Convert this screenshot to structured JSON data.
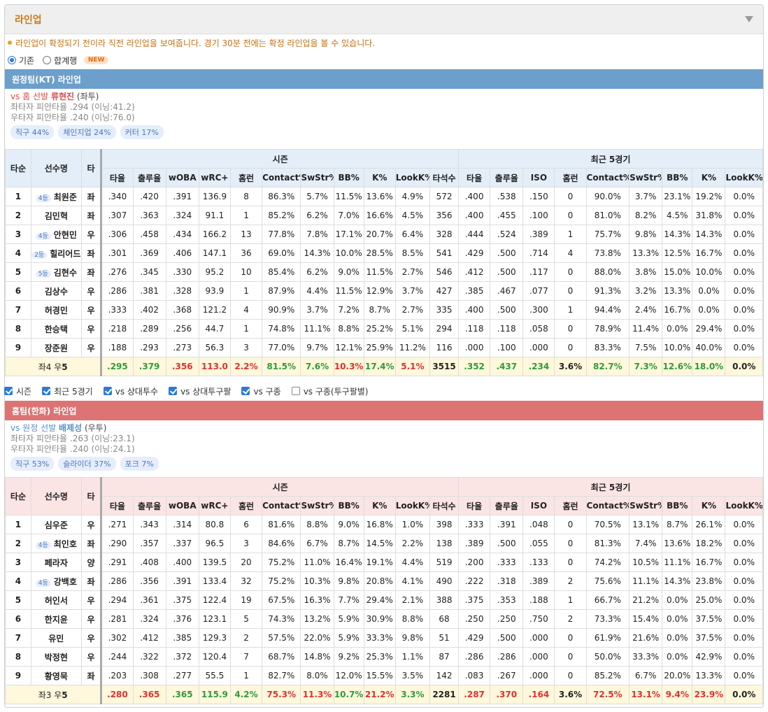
{
  "panel": {
    "title": "라인업"
  },
  "notice": "라인업이 확정되기 전이라 직전 라인업을 보여줍니다. 경기 30분 전에는 확정 라인업을 볼 수 있습니다.",
  "view_options": {
    "basic": "기존",
    "combined": "합계행",
    "new_badge": "NEW"
  },
  "header": {
    "order": "타순",
    "name": "선수명",
    "hand": "타",
    "season": "시즌",
    "recent": "최근 5경기",
    "season_cols": [
      "타율",
      "출루율",
      "wOBA",
      "wRC+",
      "홈런",
      "Contact%",
      "SwStr%",
      "BB%",
      "K%",
      "LookK%",
      "타석수"
    ],
    "recent_cols": [
      "타율",
      "출루율",
      "ISO",
      "홈런",
      "Contact%",
      "SwStr%",
      "BB%",
      "K%",
      "LookK%"
    ]
  },
  "away": {
    "title": "원정팀(KT) 라인업",
    "vs_prefix": "vs 홈 선발",
    "pitcher": "류현진",
    "pitcher_hand": "(좌투)",
    "split_left": "좌타자 피안타율 .294 (이닝:41.2)",
    "split_right": "우타자 피안타율 .240 (이닝:76.0)",
    "chips": [
      "직구 44%",
      "체인지업 24%",
      "커터 17%"
    ],
    "rows": [
      [
        "1",
        "4등",
        "최원준",
        "좌",
        ".340",
        ".420",
        ".391",
        "136.9",
        "8",
        "86.3%",
        "5.7%",
        "11.5%",
        "13.6%",
        "4.9%",
        "572",
        ".400",
        ".538",
        ".150",
        "0",
        "90.0%",
        "3.7%",
        "23.1%",
        "19.2%",
        "0.0%"
      ],
      [
        "2",
        "",
        "김민혁",
        "좌",
        ".307",
        ".363",
        ".324",
        "91.1",
        "1",
        "85.2%",
        "6.2%",
        "7.0%",
        "16.6%",
        "4.5%",
        "356",
        ".400",
        ".455",
        ".100",
        "0",
        "81.0%",
        "8.2%",
        "4.5%",
        "31.8%",
        "0.0%"
      ],
      [
        "3",
        "4등",
        "안현민",
        "우",
        ".306",
        ".458",
        ".434",
        "166.2",
        "13",
        "77.8%",
        "7.8%",
        "17.1%",
        "20.7%",
        "6.4%",
        "328",
        ".444",
        ".524",
        ".389",
        "1",
        "75.7%",
        "9.8%",
        "14.3%",
        "14.3%",
        "0.0%"
      ],
      [
        "4",
        "2등",
        "힐리어드",
        "좌",
        ".301",
        ".369",
        ".406",
        "147.1",
        "36",
        "69.0%",
        "14.3%",
        "10.0%",
        "28.5%",
        "8.5%",
        "541",
        ".429",
        ".500",
        ".714",
        "4",
        "73.8%",
        "13.3%",
        "12.5%",
        "16.7%",
        "0.0%"
      ],
      [
        "5",
        "5등",
        "김현수",
        "좌",
        ".276",
        ".345",
        ".330",
        "95.2",
        "10",
        "85.4%",
        "6.2%",
        "9.0%",
        "11.5%",
        "2.7%",
        "546",
        ".412",
        ".500",
        ".117",
        "0",
        "88.0%",
        "3.8%",
        "15.0%",
        "10.0%",
        "0.0%"
      ],
      [
        "6",
        "",
        "김상수",
        "우",
        ".286",
        ".381",
        ".328",
        "93.9",
        "1",
        "87.9%",
        "4.4%",
        "11.5%",
        "12.9%",
        "3.7%",
        "427",
        ".385",
        ".467",
        ".077",
        "0",
        "91.3%",
        "3.2%",
        "13.3%",
        "0.0%",
        "0.0%"
      ],
      [
        "7",
        "",
        "허경민",
        "우",
        ".333",
        ".402",
        ".368",
        "121.2",
        "4",
        "90.9%",
        "3.7%",
        "7.2%",
        "8.7%",
        "2.7%",
        "335",
        ".400",
        ".500",
        ".300",
        "1",
        "94.4%",
        "2.4%",
        "16.7%",
        "0.0%",
        "0.0%"
      ],
      [
        "8",
        "",
        "한승택",
        "우",
        ".218",
        ".289",
        ".256",
        "44.7",
        "1",
        "74.8%",
        "11.1%",
        "8.8%",
        "25.2%",
        "5.1%",
        "294",
        ".118",
        ".118",
        ".058",
        "0",
        "78.9%",
        "11.4%",
        "0.0%",
        "29.4%",
        "0.0%"
      ],
      [
        "9",
        "",
        "장준원",
        "우",
        ".188",
        ".293",
        ".273",
        "56.3",
        "3",
        "77.0%",
        "9.7%",
        "12.1%",
        "25.9%",
        "11.2%",
        "116",
        ".000",
        ".100",
        ".000",
        "0",
        "83.3%",
        "7.5%",
        "10.0%",
        "40.0%",
        "0.0%"
      ]
    ],
    "total": {
      "label_a": "좌4 우",
      "label_b": "5",
      "vals": [
        ".295",
        ".379",
        ".356",
        "113.0",
        "2.2%",
        "81.5%",
        "7.6%",
        "10.3%",
        "17.4%",
        "5.1%",
        "3515",
        ".352",
        ".437",
        ".234",
        "3.6%",
        "82.7%",
        "7.3%",
        "12.6%",
        "18.0%",
        "0.0%"
      ],
      "colors": [
        "g",
        "g",
        "r",
        "r",
        "r",
        "g",
        "g",
        "r",
        "g",
        "r",
        "",
        "g",
        "g",
        "g",
        "",
        "g",
        "g",
        "g",
        "g",
        ""
      ]
    }
  },
  "filters": [
    "시즌",
    "최근 5경기",
    "vs 상대투수",
    "vs 상대투구팔",
    "vs 구종",
    "vs 구종(투구팔별)"
  ],
  "home": {
    "title": "홈팀(한화) 라인업",
    "vs_prefix": "vs 원정 선발",
    "pitcher": "배제성",
    "pitcher_hand": "(우투)",
    "split_left": "좌타자 피안타율 .263 (이닝:23.1)",
    "split_right": "우타자 피안타율 .240 (이닝:24.1)",
    "chips": [
      "직구 53%",
      "슬라이더 37%",
      "포크 7%"
    ],
    "rows": [
      [
        "1",
        "",
        "심우준",
        "우",
        ".271",
        ".343",
        ".314",
        "80.8",
        "6",
        "81.6%",
        "8.8%",
        "9.0%",
        "16.8%",
        "1.0%",
        "398",
        ".333",
        ".391",
        ".048",
        "0",
        "70.5%",
        "13.1%",
        "8.7%",
        "26.1%",
        "0.0%"
      ],
      [
        "2",
        "4등",
        "최인호",
        "좌",
        ".290",
        ".357",
        ".337",
        "96.5",
        "3",
        "84.6%",
        "6.7%",
        "8.7%",
        "14.5%",
        "2.2%",
        "138",
        ".389",
        ".500",
        ".055",
        "0",
        "81.3%",
        "7.4%",
        "13.6%",
        "18.2%",
        "0.0%"
      ],
      [
        "3",
        "",
        "페라자",
        "양",
        ".291",
        ".408",
        ".400",
        "139.5",
        "20",
        "75.2%",
        "11.0%",
        "16.4%",
        "19.1%",
        "4.4%",
        "519",
        ".200",
        ".333",
        ".133",
        "0",
        "74.2%",
        "10.5%",
        "11.1%",
        "16.7%",
        "0.0%"
      ],
      [
        "4",
        "4등",
        "강백호",
        "좌",
        ".286",
        ".356",
        ".391",
        "133.4",
        "32",
        "75.2%",
        "10.3%",
        "9.8%",
        "20.8%",
        "4.1%",
        "490",
        ".222",
        ".318",
        ".389",
        "2",
        "75.6%",
        "11.1%",
        "14.3%",
        "23.8%",
        "0.0%"
      ],
      [
        "5",
        "",
        "허인서",
        "우",
        ".294",
        ".361",
        ".375",
        "122.4",
        "19",
        "67.5%",
        "16.3%",
        "7.7%",
        "29.4%",
        "2.1%",
        "388",
        ".375",
        ".353",
        ".188",
        "1",
        "66.7%",
        "21.2%",
        "0.0%",
        "25.0%",
        "0.0%"
      ],
      [
        "6",
        "",
        "한지윤",
        "우",
        ".281",
        ".324",
        ".376",
        "123.1",
        "5",
        "74.3%",
        "13.2%",
        "5.9%",
        "30.9%",
        "8.8%",
        "68",
        ".250",
        ".250",
        ".750",
        "2",
        "73.3%",
        "15.4%",
        "0.0%",
        "37.5%",
        "0.0%"
      ],
      [
        "7",
        "",
        "유민",
        "우",
        ".302",
        ".412",
        ".385",
        "129.3",
        "2",
        "57.5%",
        "22.0%",
        "5.9%",
        "33.3%",
        "9.8%",
        "51",
        ".429",
        ".500",
        ".000",
        "0",
        "61.9%",
        "21.6%",
        "0.0%",
        "37.5%",
        "0.0%"
      ],
      [
        "8",
        "",
        "박정현",
        "우",
        ".244",
        ".322",
        ".372",
        "120.4",
        "7",
        "68.7%",
        "14.8%",
        "9.2%",
        "25.3%",
        "1.1%",
        "87",
        ".286",
        ".286",
        ".000",
        "0",
        "50.0%",
        "33.3%",
        "0.0%",
        "42.9%",
        "0.0%"
      ],
      [
        "9",
        "",
        "황영묵",
        "좌",
        ".203",
        ".308",
        ".277",
        "55.5",
        "1",
        "82.7%",
        "8.0%",
        "12.0%",
        "15.5%",
        "3.5%",
        "142",
        ".083",
        ".267",
        ".000",
        "0",
        "85.2%",
        "6.7%",
        "20.0%",
        "13.3%",
        "0.0%"
      ]
    ],
    "total": {
      "label_a": "좌3 우",
      "label_b": "5",
      "vals": [
        ".280",
        ".365",
        ".365",
        "115.9",
        "4.2%",
        "75.3%",
        "11.3%",
        "10.7%",
        "21.2%",
        "3.3%",
        "2281",
        ".287",
        ".370",
        ".164",
        "3.6%",
        "72.5%",
        "13.1%",
        "9.4%",
        "23.9%",
        "0.0%"
      ],
      "colors": [
        "r",
        "r",
        "g",
        "g",
        "g",
        "r",
        "r",
        "g",
        "r",
        "g",
        "",
        "r",
        "r",
        "r",
        "",
        "r",
        "r",
        "r",
        "r",
        ""
      ]
    }
  },
  "colors": {
    "accent_orange": "#c97a17",
    "away_bar": "#6c9fcb",
    "home_bar": "#dd7373",
    "green": "#2e9a3a",
    "red": "#e03030"
  }
}
